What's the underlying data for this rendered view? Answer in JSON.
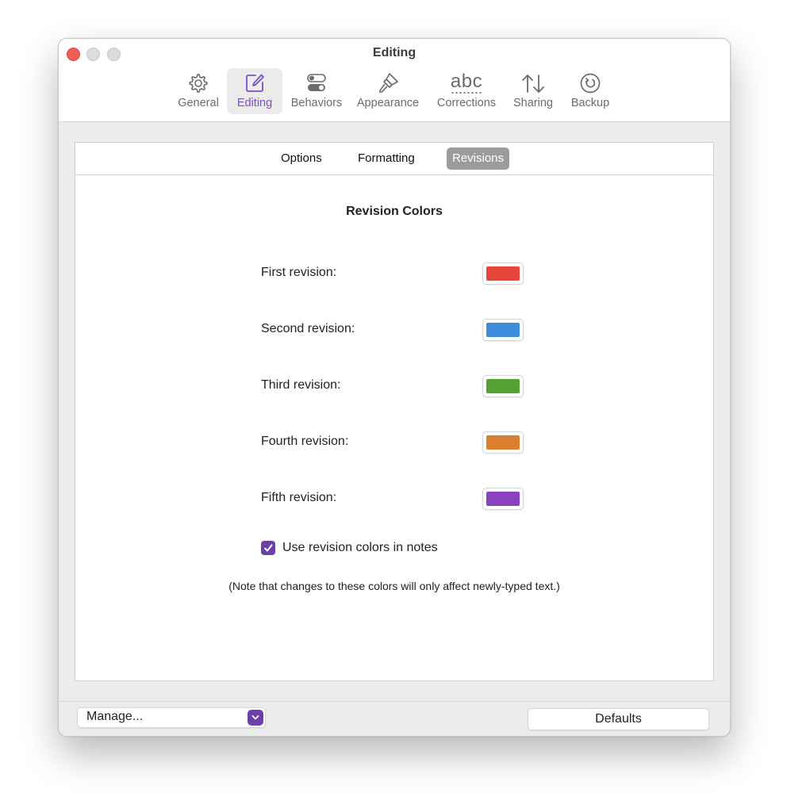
{
  "window": {
    "title": "Editing"
  },
  "toolbar": {
    "items": [
      {
        "label": "General",
        "icon": "gear-icon"
      },
      {
        "label": "Editing",
        "icon": "edit-icon"
      },
      {
        "label": "Behaviors",
        "icon": "toggles-icon"
      },
      {
        "label": "Appearance",
        "icon": "paintbrush-icon"
      },
      {
        "label": "Corrections",
        "icon": "abc-spellcheck-icon",
        "icon_text": "abc"
      },
      {
        "label": "Sharing",
        "icon": "up-down-arrows-icon"
      },
      {
        "label": "Backup",
        "icon": "backup-clock-icon"
      }
    ],
    "active_index": 1,
    "accent_color": "#7c4fc4"
  },
  "segments": {
    "items": [
      "Options",
      "Formatting",
      "Revisions"
    ],
    "active_index": 2
  },
  "revisions": {
    "title": "Revision Colors",
    "rows": [
      {
        "label": "First revision:",
        "color": "#e8453a"
      },
      {
        "label": "Second revision:",
        "color": "#3f8cdc"
      },
      {
        "label": "Third revision:",
        "color": "#55a234"
      },
      {
        "label": "Fourth revision:",
        "color": "#d97f2e"
      },
      {
        "label": "Fifth revision:",
        "color": "#8a42c0"
      }
    ],
    "checkbox": {
      "label": "Use revision colors in notes",
      "checked": true
    },
    "note": "(Note that changes to these colors will only affect newly-typed text.)"
  },
  "footer": {
    "manage_label": "Manage...",
    "defaults_label": "Defaults"
  }
}
